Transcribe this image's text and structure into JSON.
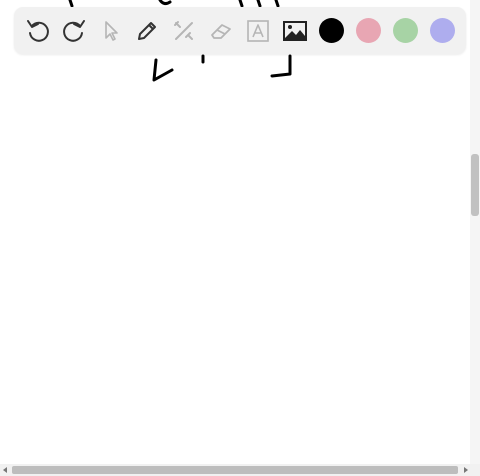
{
  "toolbar": {
    "tools": [
      {
        "id": "undo",
        "icon": "undo-icon",
        "enabled": true
      },
      {
        "id": "redo",
        "icon": "redo-icon",
        "enabled": true
      },
      {
        "id": "select",
        "icon": "select-arrow-icon",
        "enabled": false
      },
      {
        "id": "pen",
        "icon": "pen-icon",
        "enabled": true
      },
      {
        "id": "tools",
        "icon": "tools-icon",
        "enabled": false
      },
      {
        "id": "eraser",
        "icon": "eraser-icon",
        "enabled": false
      },
      {
        "id": "text",
        "icon": "text-icon",
        "enabled": false
      },
      {
        "id": "image",
        "icon": "image-icon",
        "enabled": true
      }
    ],
    "colors": [
      {
        "name": "black",
        "hex": "#000000"
      },
      {
        "name": "pink",
        "hex": "#e8a6b3"
      },
      {
        "name": "green",
        "hex": "#a7d3a5"
      },
      {
        "name": "purple",
        "hex": "#aeadee"
      }
    ]
  },
  "canvas": {
    "background": "#ffffff",
    "stroke_color": "#000000"
  },
  "scrollbars": {
    "vertical_position": 0.33,
    "horizontal_position": 0.0
  }
}
